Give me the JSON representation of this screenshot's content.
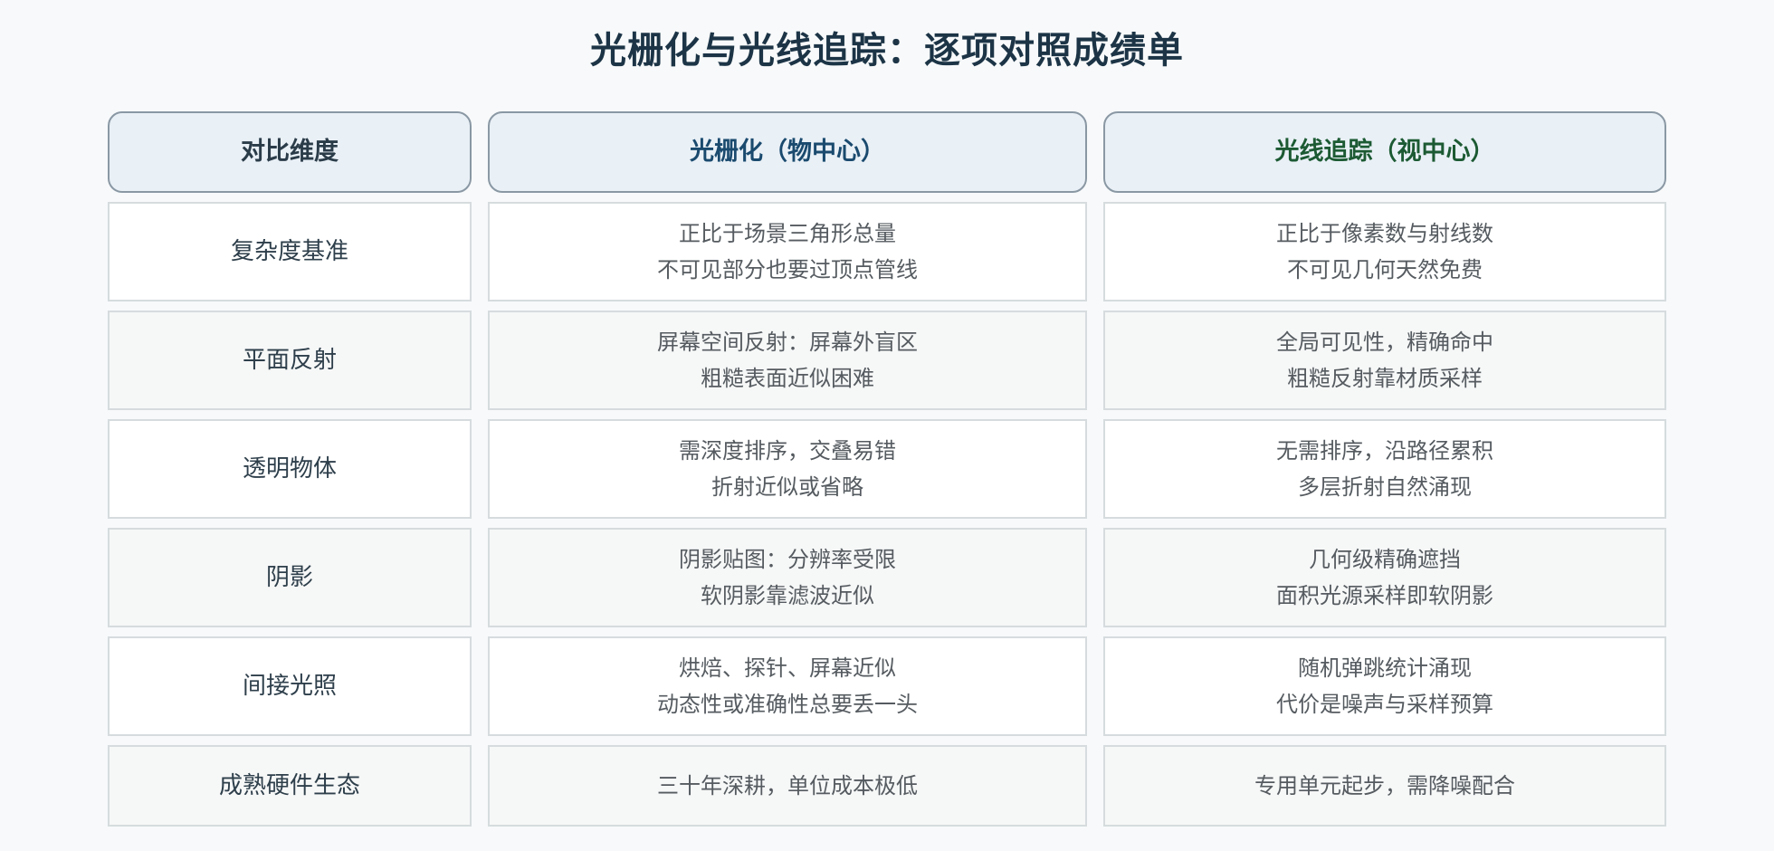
{
  "title": "光栅化与光线追踪：逐项对照成绩单",
  "headers": [
    "对比维度",
    "光栅化（物中心）",
    "光线追踪（视中心）"
  ],
  "rows": [
    {
      "dimension": "复杂度基准",
      "raster": [
        "正比于场景三角形总量",
        "不可见部分也要过顶点管线"
      ],
      "ray": [
        "正比于像素数与射线数",
        "不可见几何天然免费"
      ]
    },
    {
      "dimension": "平面反射",
      "raster": [
        "屏幕空间反射：屏幕外盲区",
        "粗糙表面近似困难"
      ],
      "ray": [
        "全局可见性，精确命中",
        "粗糙反射靠材质采样"
      ]
    },
    {
      "dimension": "透明物体",
      "raster": [
        "需深度排序，交叠易错",
        "折射近似或省略"
      ],
      "ray": [
        "无需排序，沿路径累积",
        "多层折射自然涌现"
      ]
    },
    {
      "dimension": "阴影",
      "raster": [
        "阴影贴图：分辨率受限",
        "软阴影靠滤波近似"
      ],
      "ray": [
        "几何级精确遮挡",
        "面积光源采样即软阴影"
      ]
    },
    {
      "dimension": "间接光照",
      "raster": [
        "烘焙、探针、屏幕近似",
        "动态性或准确性总要丢一头"
      ],
      "ray": [
        "随机弹跳统计涌现",
        "代价是噪声与采样预算"
      ]
    },
    {
      "dimension": "成熟硬件生态",
      "raster": [
        "三十年深耕，单位成本极低"
      ],
      "ray": [
        "专用单元起步，需降噪配合"
      ]
    }
  ],
  "colors": {
    "title": "#1c3446",
    "header_dimension": "#2b3c49",
    "header_raster": "#1a4a6e",
    "header_ray": "#1c5a33",
    "header_bg": "#e9f0f6",
    "cell_border": "#d6dcde",
    "body_text": "#555b60"
  }
}
